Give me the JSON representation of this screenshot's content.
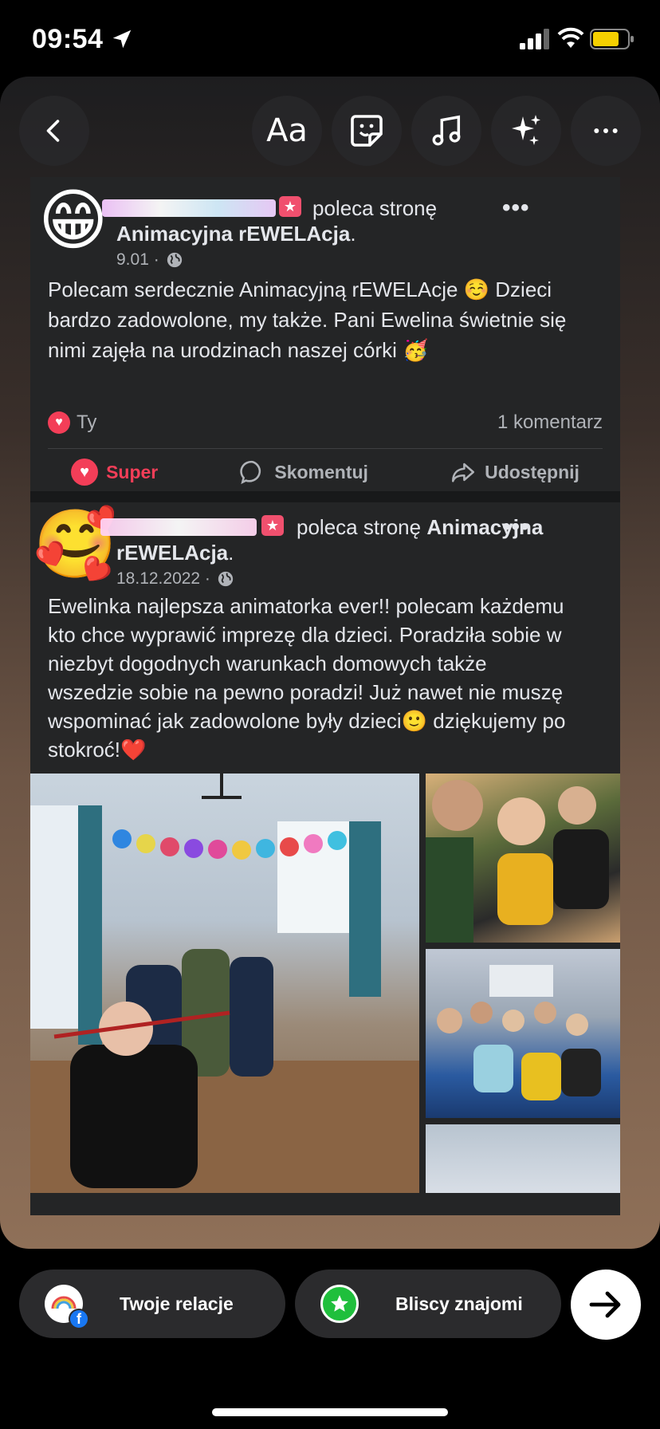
{
  "status": {
    "time": "09:54"
  },
  "toolbar": {
    "text_label": "Aa"
  },
  "post1": {
    "action_text": "poleca stronę",
    "page_name": "Animacyjna rEWELAcja",
    "page_suffix": ".",
    "date": "9.01 ·",
    "body_lines": [
      "Polecam serdecznie Animacyjną rEWELAcje ☺️ Dzieci",
      "bardzo zadowolone, my także. Pani Ewelina świetnie się",
      "nimi zajęła na urodzinach naszej córki 🥳"
    ],
    "reactions_label": "Ty",
    "comments_count": "1 komentarz",
    "like_label": "Super",
    "comment_label": "Skomentuj",
    "share_label": "Udostępnij"
  },
  "post2": {
    "action_text": "poleca stronę",
    "page_name_line1": "Animacyjna",
    "page_name_line2": "rEWELAcja",
    "page_suffix": ".",
    "date": "18.12.2022 ·",
    "body_lines": [
      "Ewelinka najlepsza animatorka ever!! polecam każdemu",
      "kto chce wyprawić imprezę dla dzieci. Poradziła sobie w",
      "niezbyt dogodnych warunkach domowych także",
      "wszedzie sobie na pewno poradzi! Już nawet nie muszę",
      "wspominać jak zadowolone były dzieci🙂 dziękujemy po",
      "stokroć!❤️"
    ]
  },
  "bottom": {
    "your_story_label": "Twoje relacje",
    "close_friends_label": "Bliscy znajomi"
  },
  "colors": {
    "accent_red": "#f33e58",
    "card_bg": "#242526",
    "close_friends_green": "#1fbf3c"
  }
}
